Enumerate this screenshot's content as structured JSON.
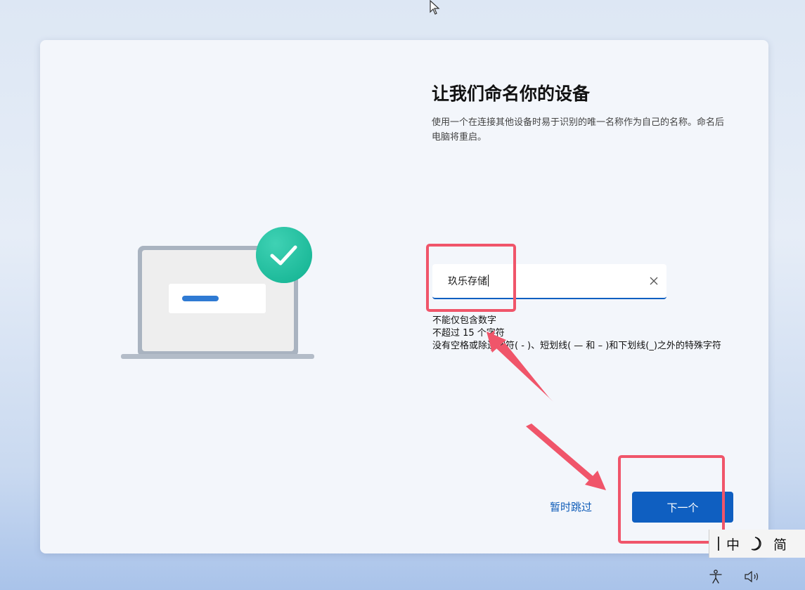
{
  "page": {
    "title": "让我们命名你的设备",
    "description": "使用一个在连接其他设备时易于识别的唯一名称作为自己的名称。命名后电脑将重启。"
  },
  "device_name_input": {
    "value": "玖乐存储"
  },
  "rules": [
    "不能仅包含数字",
    "不超过 15 个字符",
    "没有空格或除连字符( - )、短划线( — 和 – )和下划线(_)之外的特殊字符"
  ],
  "actions": {
    "skip_label": "暂时跳过",
    "next_label": "下一个"
  },
  "ime": {
    "language": "中",
    "mode": "简"
  },
  "colors": {
    "accent": "#0f5fc1",
    "annotation": "#f0556a",
    "check_badge": "#1fc3a3"
  },
  "icons": {
    "clear": "close-icon",
    "check": "checkmark-icon",
    "moon": "moon-icon",
    "accessibility": "accessibility-icon",
    "volume": "volume-icon"
  }
}
